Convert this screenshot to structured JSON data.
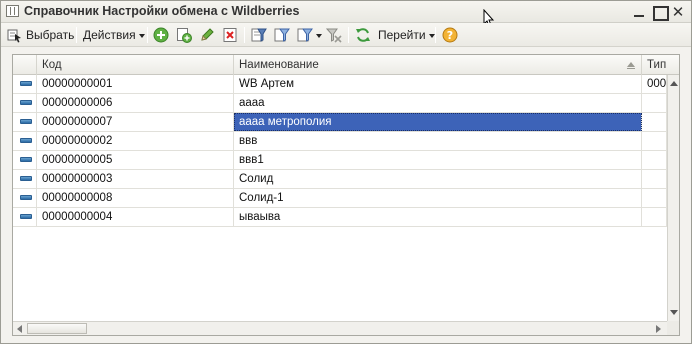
{
  "window": {
    "title": "Справочник Настройки обмена с Wildberries",
    "title_icon": "list-window-icon",
    "controls": [
      "minimize-icon",
      "maximize-icon",
      "close-icon"
    ]
  },
  "toolbar": {
    "select_label": "Выбрать",
    "actions_label": "Действия",
    "goto_label": "Перейти",
    "icons": [
      "add-icon",
      "add-copy-icon",
      "edit-icon",
      "delete-icon",
      "filter-icon",
      "filter-by-value-icon",
      "filter-history-icon",
      "clear-filter-icon",
      "refresh-icon",
      "help-icon"
    ]
  },
  "table": {
    "columns": [
      "Код",
      "Наименование",
      "Тип"
    ],
    "sorted_column": "Наименование",
    "selected_row_index": 2,
    "rows": [
      {
        "code": "00000000001",
        "name": "WB Артем",
        "type": "000"
      },
      {
        "code": "00000000006",
        "name": "аааа",
        "type": ""
      },
      {
        "code": "00000000007",
        "name": "аааа метрополия",
        "type": ""
      },
      {
        "code": "00000000002",
        "name": "ввв",
        "type": ""
      },
      {
        "code": "00000000005",
        "name": "ввв1",
        "type": ""
      },
      {
        "code": "00000000003",
        "name": "Солид",
        "type": ""
      },
      {
        "code": "00000000008",
        "name": "Солид-1",
        "type": ""
      },
      {
        "code": "00000000004",
        "name": "ываыва",
        "type": ""
      }
    ]
  },
  "colors": {
    "selection": "#3d63b8",
    "row_icon": "#2b6aa5",
    "window_bg": "#f3f2ee"
  }
}
